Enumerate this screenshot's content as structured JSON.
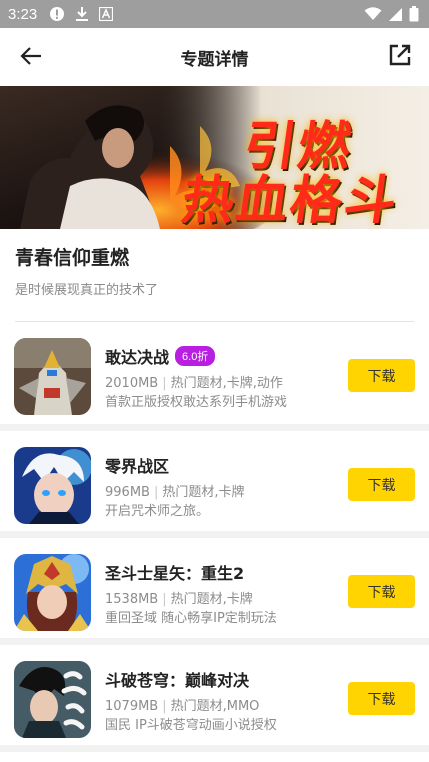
{
  "status_bar": {
    "time": "3:23",
    "left_icons": [
      "alert-circle-icon",
      "download-icon",
      "font-a-icon"
    ],
    "right_icons": [
      "wifi-icon",
      "signal-icon",
      "battery-icon"
    ]
  },
  "app_bar": {
    "title": "专题详情",
    "back_icon": "arrow-back-icon",
    "share_icon": "open-external-icon"
  },
  "banner": {
    "line1": "引燃",
    "line2": "热血格斗"
  },
  "topic": {
    "title": "青春信仰重燃",
    "description": "是时候展现真正的技术了"
  },
  "apps": [
    {
      "name": "敢达决战",
      "badge": "6.0折",
      "size": "2010MB",
      "tags": "热门题材,卡牌,动作",
      "desc": "首款正版授权敢达系列手机游戏",
      "button": "下载"
    },
    {
      "name": "零界战区",
      "badge": "",
      "size": "996MB",
      "tags": "热门题材,卡牌",
      "desc": "开启咒术师之旅。",
      "button": "下载"
    },
    {
      "name": "圣斗士星矢：重生2",
      "badge": "",
      "size": "1538MB",
      "tags": "热门题材,卡牌",
      "desc": "重回圣域 随心畅享IP定制玩法",
      "button": "下载"
    },
    {
      "name": "斗破苍穹：巅峰对决",
      "badge": "",
      "size": "1079MB",
      "tags": "热门题材,MMO",
      "desc": "国民 IP斗破苍穹动画小说授权",
      "button": "下载"
    }
  ],
  "colors": {
    "accent_button": "#ffd400",
    "badge": "#b81fe0",
    "status_bar": "#9e9e9e"
  }
}
